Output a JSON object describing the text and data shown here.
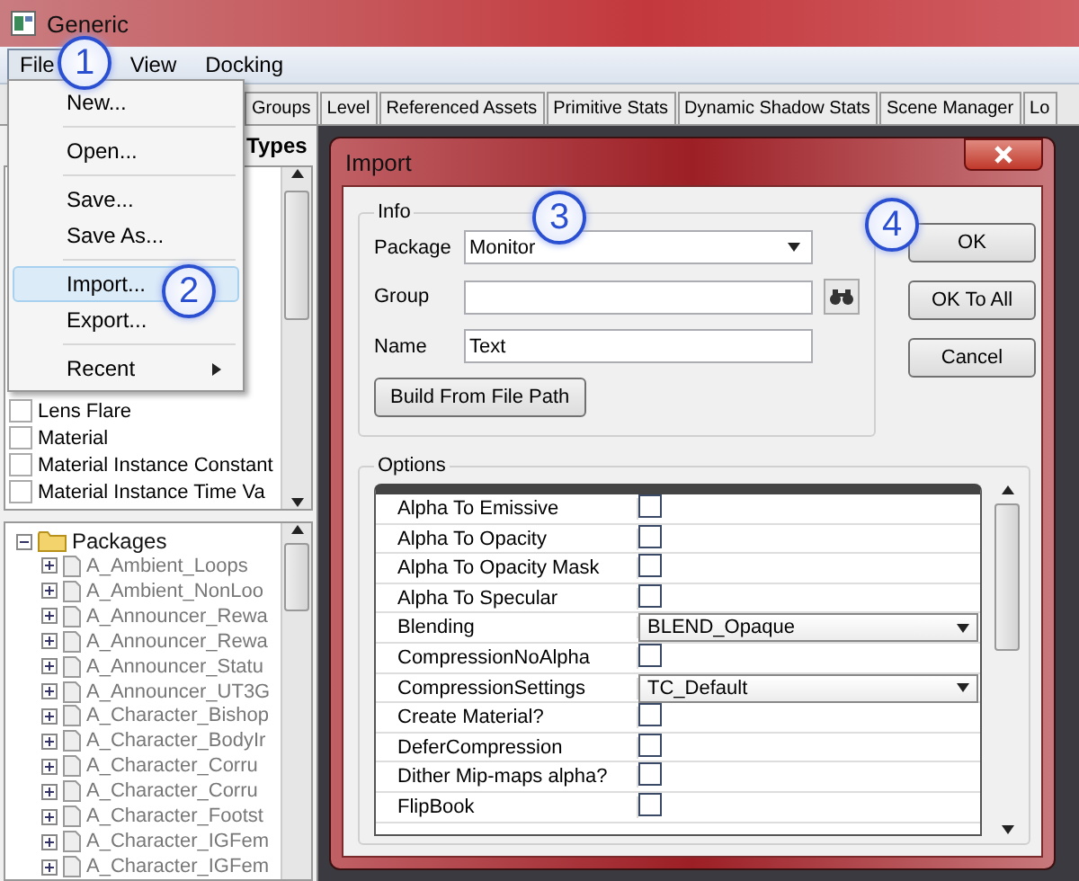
{
  "window": {
    "title": "Generic"
  },
  "menubar": [
    {
      "label": "File",
      "selected": true
    },
    {
      "label": "View",
      "selected": false
    },
    {
      "label": "Docking",
      "selected": false
    }
  ],
  "file_menu": [
    {
      "label": "New...",
      "highlighted": false,
      "submenu": false
    },
    {
      "label": "Open...",
      "highlighted": false,
      "submenu": false
    },
    {
      "label": "Save...",
      "highlighted": false,
      "submenu": false
    },
    {
      "label": "Save As...",
      "highlighted": false,
      "submenu": false
    },
    {
      "label": "Import...",
      "highlighted": true,
      "submenu": false
    },
    {
      "label": "Export...",
      "highlighted": false,
      "submenu": false
    },
    {
      "label": "Recent",
      "highlighted": false,
      "submenu": true
    }
  ],
  "tabs": [
    {
      "label": "Groups",
      "selected": false
    },
    {
      "label": "Level",
      "selected": false
    },
    {
      "label": "Referenced Assets",
      "selected": false
    },
    {
      "label": "Primitive Stats",
      "selected": false
    },
    {
      "label": "Dynamic Shadow Stats",
      "selected": false
    },
    {
      "label": "Scene Manager",
      "selected": false
    },
    {
      "label": "Lo",
      "selected": false
    }
  ],
  "types_panel": {
    "header": "Types",
    "items": [
      {
        "label": "Lens Flare",
        "checked": false
      },
      {
        "label": "Material",
        "checked": false
      },
      {
        "label": "Material Instance Constant",
        "checked": false
      },
      {
        "label": "Material Instance Time Va",
        "checked": false
      }
    ]
  },
  "packages_tree": {
    "label": "Packages",
    "expanded": true,
    "children": [
      {
        "label": "A_Ambient_Loops",
        "expanded": false
      },
      {
        "label": "A_Ambient_NonLoo",
        "expanded": false
      },
      {
        "label": "A_Announcer_Rewa",
        "expanded": false
      },
      {
        "label": "A_Announcer_Rewa",
        "expanded": false
      },
      {
        "label": "A_Announcer_Statu",
        "expanded": false
      },
      {
        "label": "A_Announcer_UT3G",
        "expanded": false
      },
      {
        "label": "A_Character_Bishop",
        "expanded": false
      },
      {
        "label": "A_Character_BodyIr",
        "expanded": false
      },
      {
        "label": "A_Character_Corru",
        "expanded": false
      },
      {
        "label": "A_Character_Corru",
        "expanded": false
      },
      {
        "label": "A_Character_Footst",
        "expanded": false
      },
      {
        "label": "A_Character_IGFem",
        "expanded": false
      },
      {
        "label": "A_Character_IGFem",
        "expanded": false
      }
    ]
  },
  "dialog": {
    "title": "Import",
    "info": {
      "legend": "Info",
      "fields": [
        {
          "label": "Package",
          "value": "Monitor",
          "kind": "combo"
        },
        {
          "label": "Group",
          "kind": "search"
        },
        {
          "label": "Name",
          "value": "Text",
          "kind": "text"
        }
      ],
      "build_button": "Build From File Path"
    },
    "buttons": [
      "OK",
      "OK To All",
      "Cancel"
    ],
    "options": {
      "legend": "Options",
      "rows": [
        {
          "label": "Alpha To Emissive",
          "kind": "checkbox",
          "checked": false
        },
        {
          "label": "Alpha To Opacity",
          "kind": "checkbox",
          "checked": false
        },
        {
          "label": "Alpha To Opacity Mask",
          "kind": "checkbox",
          "checked": false
        },
        {
          "label": "Alpha To Specular",
          "kind": "checkbox",
          "checked": false
        },
        {
          "label": "Blending",
          "kind": "dropdown",
          "value": "BLEND_Opaque"
        },
        {
          "label": "CompressionNoAlpha",
          "kind": "checkbox",
          "checked": false
        },
        {
          "label": "CompressionSettings",
          "kind": "dropdown",
          "value": "TC_Default"
        },
        {
          "label": "Create Material?",
          "kind": "checkbox",
          "checked": false
        },
        {
          "label": "DeferCompression",
          "kind": "checkbox",
          "checked": false
        },
        {
          "label": "Dither Mip-maps alpha?",
          "kind": "checkbox",
          "checked": false
        },
        {
          "label": "FlipBook",
          "kind": "checkbox",
          "checked": false
        }
      ]
    }
  },
  "callouts": [
    "1",
    "2",
    "3",
    "4"
  ]
}
